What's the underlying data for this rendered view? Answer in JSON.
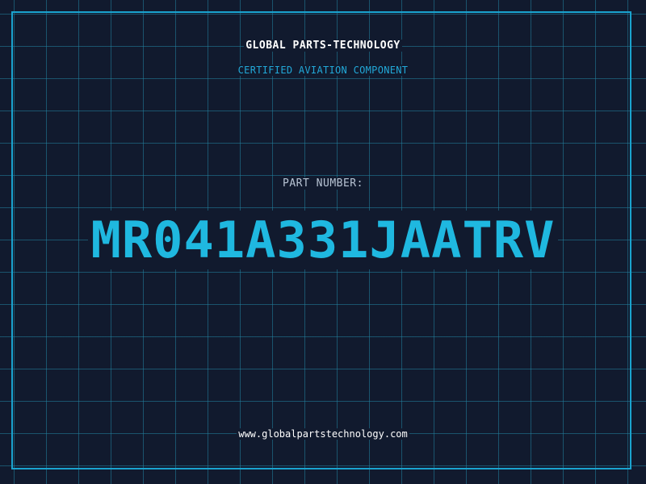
{
  "header": {
    "company": "GLOBAL PARTS-TECHNOLOGY",
    "subtitle": "CERTIFIED AVIATION COMPONENT"
  },
  "part": {
    "label": "PART NUMBER:",
    "number": "MR041A331JAATRV"
  },
  "footer": {
    "website": "www.globalpartstechnology.com"
  },
  "colors": {
    "background": "#111a2e",
    "grid": "#2282a0",
    "accent": "#1fb8e0",
    "frame": "#1aa3cf",
    "text_primary": "#ffffff",
    "text_muted": "#b8c4d4"
  }
}
